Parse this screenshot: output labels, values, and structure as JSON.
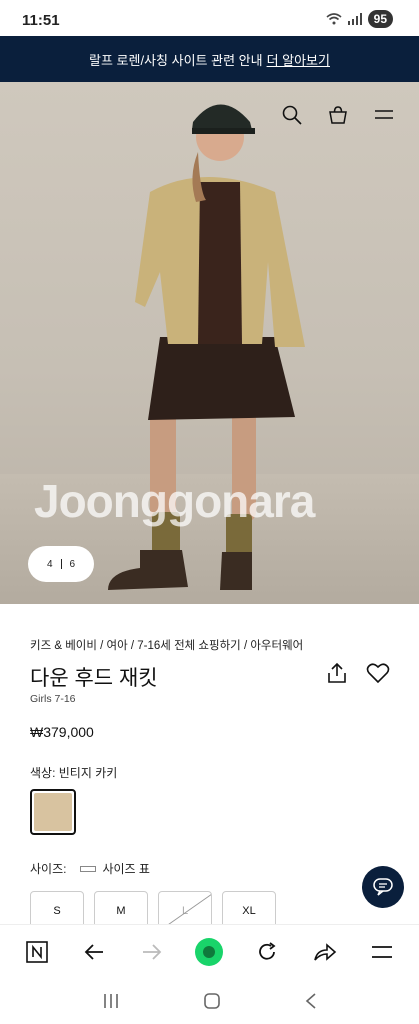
{
  "status": {
    "time": "11:51",
    "battery": "95"
  },
  "banner": {
    "text": "랄프 로렌/사칭 사이트 관련 안내",
    "link": "더 알아보기"
  },
  "hero": {
    "watermark": "Joonggonara",
    "pager_current": "4",
    "pager_total": "6"
  },
  "product": {
    "breadcrumb": "키즈 & 베이비  /  여아  /  7-16세 전체 쇼핑하기  /  아우터웨어",
    "title": "다운 후드 재킷",
    "subtitle": "Girls 7-16",
    "price": "₩379,000",
    "color_label": "색상: 빈티지 카키",
    "color_swatch": "#d8c3a0",
    "size_label": "사이즈:",
    "size_guide": "사이즈 표",
    "sizes": [
      "S",
      "M",
      "L",
      "XL"
    ],
    "unavailable_sizes": [
      "L"
    ]
  },
  "colors": {
    "banner_bg": "#0a1f3c",
    "chat_fab": "#0a1f3c",
    "home_green": "#19d46a"
  }
}
